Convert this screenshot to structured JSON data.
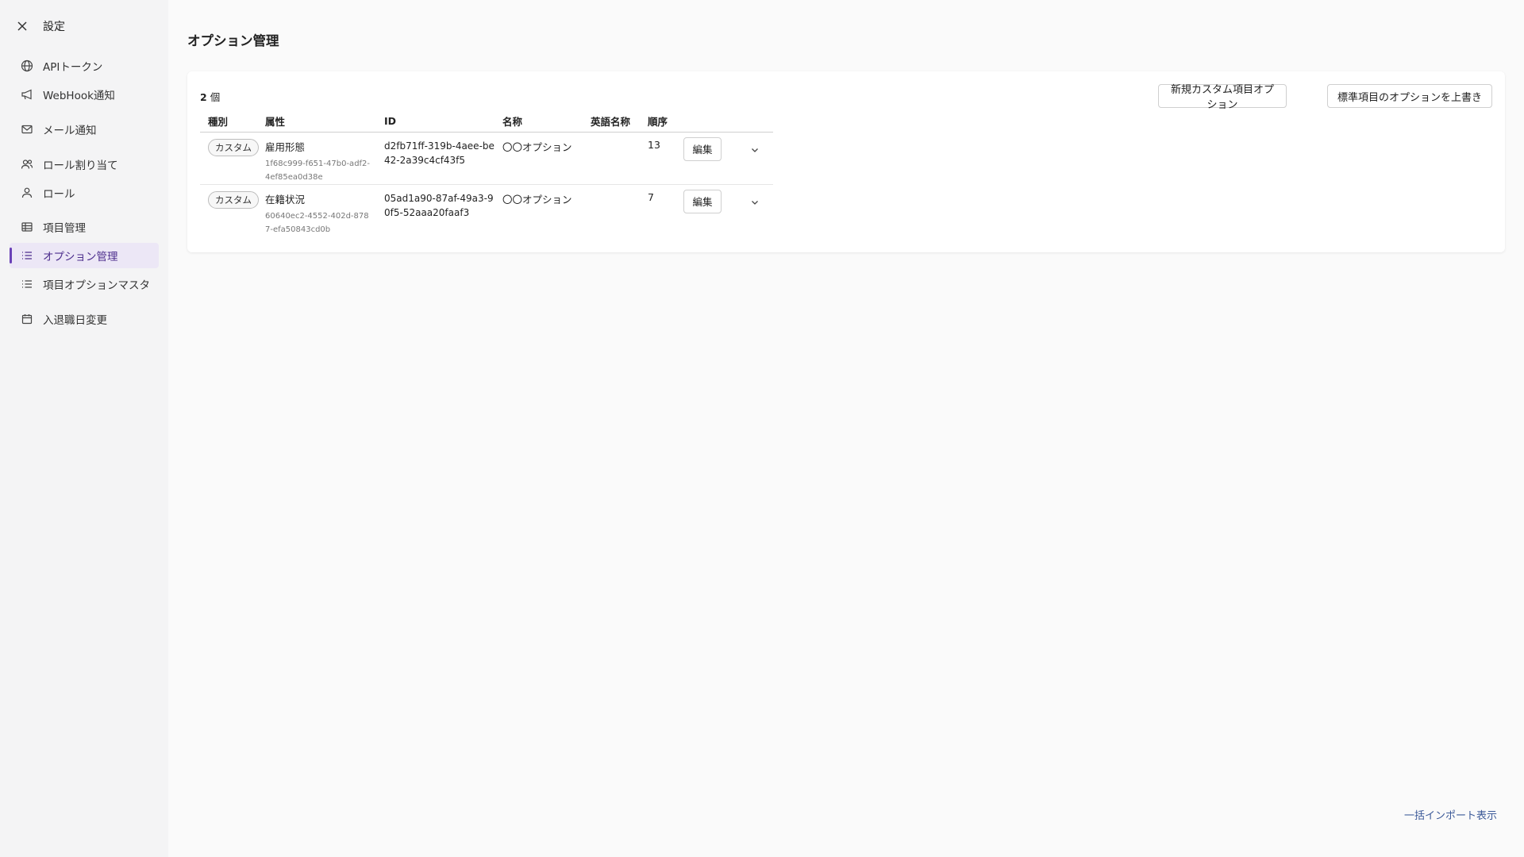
{
  "sidebar": {
    "title": "設定",
    "items": [
      {
        "label": "APIトークン",
        "icon": "globe-icon"
      },
      {
        "label": "WebHook通知",
        "icon": "megaphone-icon"
      },
      {
        "label": "メール通知",
        "icon": "mail-icon"
      },
      {
        "label": "ロール割り当て",
        "icon": "users-icon"
      },
      {
        "label": "ロール",
        "icon": "user-icon"
      },
      {
        "label": "項目管理",
        "icon": "table-icon"
      },
      {
        "label": "オプション管理",
        "icon": "list-icon",
        "active": true
      },
      {
        "label": "項目オプションマスタ",
        "icon": "list-icon"
      },
      {
        "label": "入退職日変更",
        "icon": "calendar-icon"
      }
    ]
  },
  "page": {
    "title": "オプション管理",
    "count_number": "2",
    "count_unit": "個",
    "new_button": "新規カスタム項目オプション",
    "override_button": "標準項目のオプションを上書き",
    "footer_link": "一括インポート表示"
  },
  "table": {
    "headers": {
      "kind": "種別",
      "attr": "属性",
      "id": "ID",
      "name": "名称",
      "english_name": "英語名称",
      "order": "順序"
    },
    "rows": [
      {
        "kind": "カスタム",
        "attr": "雇用形態",
        "attr_id": "1f68c999-f651-47b0-adf2-4ef85ea0d38e",
        "id": "d2fb71ff-319b-4aee-be42-2a39c4cf43f5",
        "name": "〇〇オプション",
        "english_name": "",
        "order": "13",
        "edit_label": "編集"
      },
      {
        "kind": "カスタム",
        "attr": "在籍状況",
        "attr_id": "60640ec2-4552-402d-8787-efa50843cd0b",
        "id": "05ad1a90-87af-49a3-90f5-52aaa20faaf3",
        "name": "〇〇オプション",
        "english_name": "",
        "order": "7",
        "edit_label": "編集"
      }
    ]
  },
  "colors": {
    "accent": "#6a41b7",
    "active_bg": "#ece7f6",
    "link": "#3b5998"
  }
}
